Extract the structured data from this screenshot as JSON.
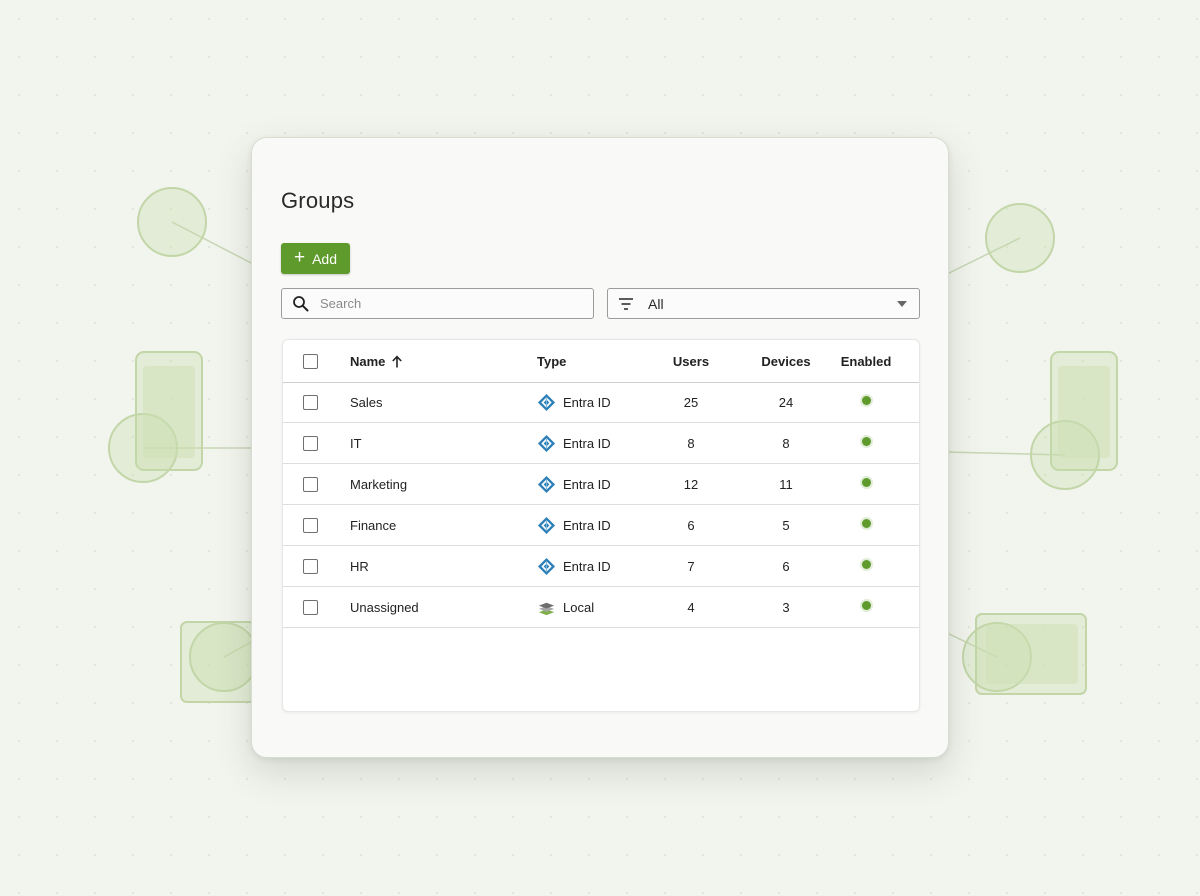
{
  "page": {
    "title": "Groups"
  },
  "toolbar": {
    "add_label": "Add"
  },
  "search": {
    "placeholder": "Search",
    "value": ""
  },
  "filter": {
    "value": "All"
  },
  "table": {
    "headers": {
      "name": "Name",
      "type": "Type",
      "users": "Users",
      "devices": "Devices",
      "enabled": "Enabled"
    },
    "rows": [
      {
        "name": "Sales",
        "type": "Entra ID",
        "type_icon": "entra-id-icon",
        "users": "25",
        "devices": "24",
        "enabled": true
      },
      {
        "name": "IT",
        "type": "Entra ID",
        "type_icon": "entra-id-icon",
        "users": "8",
        "devices": "8",
        "enabled": true
      },
      {
        "name": "Marketing",
        "type": "Entra ID",
        "type_icon": "entra-id-icon",
        "users": "12",
        "devices": "11",
        "enabled": true
      },
      {
        "name": "Finance",
        "type": "Entra ID",
        "type_icon": "entra-id-icon",
        "users": "6",
        "devices": "5",
        "enabled": true
      },
      {
        "name": "HR",
        "type": "Entra ID",
        "type_icon": "entra-id-icon",
        "users": "7",
        "devices": "6",
        "enabled": true
      },
      {
        "name": "Unassigned",
        "type": "Local",
        "type_icon": "local-layers-icon",
        "users": "4",
        "devices": "3",
        "enabled": true
      }
    ]
  },
  "colors": {
    "accent": "#5f9a2c",
    "enabled_dot": "#5f9a2c",
    "entra_icon": "#2d7fb8"
  },
  "icons": {
    "search": "search-icon",
    "filter": "filter-icon",
    "dropdown": "chevron-down-icon",
    "sort": "arrow-up-icon",
    "add": "plus-icon"
  }
}
